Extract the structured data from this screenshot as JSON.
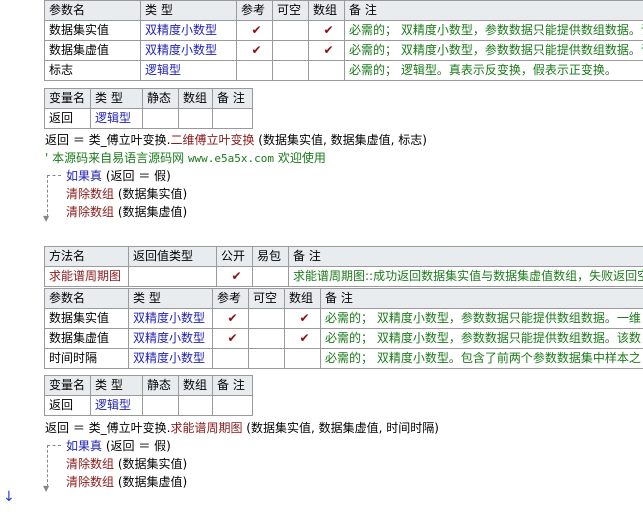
{
  "check": "✔",
  "t1": {
    "headers": [
      "参数名",
      "类 型",
      "参考",
      "可空",
      "数组",
      "备 注"
    ],
    "rows": [
      {
        "name": "数据集实值",
        "type": "双精度小数型",
        "ref": true,
        "nullable": false,
        "array": true,
        "note": "必需的；  双精度小数型，参数数据只能提供数组数据。该"
      },
      {
        "name": "数据集虚值",
        "type": "双精度小数型",
        "ref": true,
        "nullable": false,
        "array": true,
        "note": "必需的；  双精度小数型，参数数据只能提供数组数据。该"
      },
      {
        "name": "标志",
        "type": "逻辑型",
        "ref": false,
        "nullable": false,
        "array": false,
        "note": "必需的；  逻辑型。真表示反变换，假表示正变换。"
      }
    ]
  },
  "v1": {
    "headers": [
      "变量名",
      "类 型",
      "静态",
      "数组",
      "备 注"
    ],
    "row": {
      "name": "返回",
      "type": "逻辑型",
      "static": "",
      "array": "",
      "note": ""
    }
  },
  "code1": {
    "assign_prefix": "返回 ＝ 类_傅立叶变换.",
    "method": "二维傅立叶变换",
    "args": " (数据集实值, 数据集虚值, 标志)",
    "comment_prefix": "' 本源码来自易语言源码网 ",
    "comment_url": "www.e5a5x.com",
    "comment_suffix": "  欢迎使用",
    "if_kw": "如果真",
    "if_cond": " (返回 ＝ 假)",
    "clear_kw": "清除数组",
    "clear_arg1": " (数据集实值)",
    "clear_arg2": " (数据集虚值)"
  },
  "m2": {
    "headers": [
      "方法名",
      "返回值类型",
      "公开",
      "易包",
      "备 注"
    ],
    "row": {
      "name": "求能谱周期图",
      "return_type": "",
      "public": true,
      "epkg": false,
      "note": "求能谱周期图::成功返回数据集实值与数据集虚值数组，失败返回空"
    }
  },
  "t2": {
    "headers": [
      "参数名",
      "类 型",
      "参考",
      "可空",
      "数组",
      "备 注"
    ],
    "rows": [
      {
        "name": "数据集实值",
        "type": "双精度小数型",
        "ref": true,
        "nullable": false,
        "array": true,
        "note": "必需的；  双精度小数型，参数数据只能提供数组数据。一维"
      },
      {
        "name": "数据集虚值",
        "type": "双精度小数型",
        "ref": true,
        "nullable": false,
        "array": true,
        "note": "必需的；  双精度小数型，参数数据只能提供数组数据。该数"
      },
      {
        "name": "时间时隔",
        "type": "双精度小数型",
        "ref": false,
        "nullable": false,
        "array": false,
        "note": "必需的；  双精度小数型。包含了前两个参数数据集中样本之"
      }
    ]
  },
  "v2": {
    "headers": [
      "变量名",
      "类 型",
      "静态",
      "数组",
      "备 注"
    ],
    "row": {
      "name": "返回",
      "type": "逻辑型",
      "static": "",
      "array": "",
      "note": ""
    }
  },
  "code2": {
    "assign_prefix": "返回 ＝ 类_傅立叶变换.",
    "method": "求能谱周期图",
    "args": " (数据集实值, 数据集虚值, 时间时隔)",
    "if_kw": "如果真",
    "if_cond": " (返回 ＝ 假)",
    "clear_kw": "清除数组",
    "clear_arg1": " (数据集实值)",
    "clear_arg2": " (数据集虚值)"
  },
  "gutter_icon": "down-arrow-icon"
}
